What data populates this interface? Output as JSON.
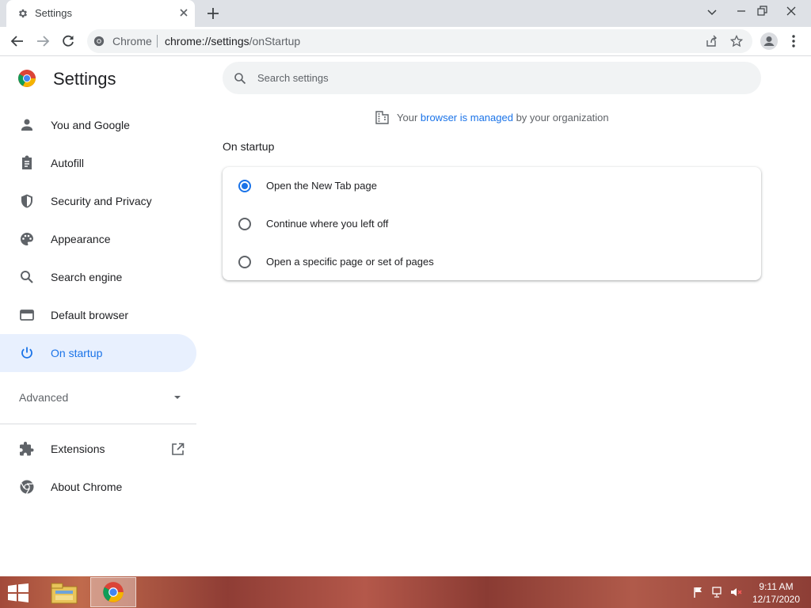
{
  "tab": {
    "title": "Settings"
  },
  "toolbar": {
    "site_name": "Chrome",
    "url_host": "chrome://settings",
    "url_path": "/onStartup"
  },
  "header": {
    "title": "Settings",
    "search_placeholder": "Search settings"
  },
  "sidebar": {
    "items": [
      {
        "label": "You and Google",
        "icon": "person-icon"
      },
      {
        "label": "Autofill",
        "icon": "clipboard-icon"
      },
      {
        "label": "Security and Privacy",
        "icon": "shield-icon"
      },
      {
        "label": "Appearance",
        "icon": "palette-icon"
      },
      {
        "label": "Search engine",
        "icon": "search-icon"
      },
      {
        "label": "Default browser",
        "icon": "browser-icon"
      },
      {
        "label": "On startup",
        "icon": "power-icon",
        "selected": true
      }
    ],
    "advanced_label": "Advanced",
    "extensions_label": "Extensions",
    "about_label": "About Chrome"
  },
  "managed": {
    "prefix": "Your ",
    "link": "browser is managed",
    "suffix": " by your organization"
  },
  "main": {
    "section_title": "On startup",
    "options": [
      {
        "label": "Open the New Tab page",
        "checked": true
      },
      {
        "label": "Continue where you left off",
        "checked": false
      },
      {
        "label": "Open a specific page or set of pages",
        "checked": false
      }
    ]
  },
  "taskbar": {
    "time": "9:11 AM",
    "date": "12/17/2020"
  },
  "colors": {
    "accent": "#1a73e8",
    "selected_bg": "#e8f0fe",
    "tabstrip": "#dee1e6",
    "omnibox": "#f1f3f4"
  }
}
